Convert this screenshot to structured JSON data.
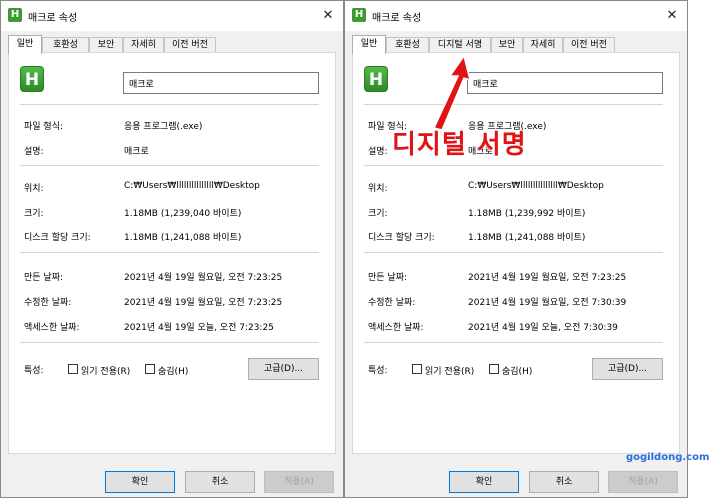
{
  "dialogs": [
    {
      "title": "매크로 속성",
      "close_glyph": "✕",
      "app_icon_letter": "H",
      "tabs": [
        "일반",
        "호환성",
        "보안",
        "자세히",
        "이전 버전"
      ],
      "filename": "매크로",
      "props": [
        {
          "label": "파일 형식:",
          "value": "응용 프로그램(.exe)"
        },
        {
          "label": "설명:",
          "value": "매크로"
        },
        {
          "label": "위치:",
          "value": "C:₩Users₩lllllllllllllll₩Desktop"
        },
        {
          "label": "크기:",
          "value": "1.18MB (1,239,040 바이트)"
        },
        {
          "label": "디스크 할당 크기:",
          "value": "1.18MB (1,241,088 바이트)"
        },
        {
          "label": "만든 날짜:",
          "value": "2021년 4월 19일 월요일, 오전 7:23:25"
        },
        {
          "label": "수정한 날짜:",
          "value": "2021년 4월 19일 월요일, 오전 7:23:25"
        },
        {
          "label": "액세스한 날짜:",
          "value": "2021년 4월 19일 오늘, 오전 7:23:25"
        }
      ],
      "attributes_label": "특성:",
      "readonly_label": "읽기 전용(R)",
      "hidden_label": "숨김(H)",
      "advanced_label": "고급(D)...",
      "ok_label": "확인",
      "cancel_label": "취소",
      "apply_label": "적용(A)"
    },
    {
      "title": "매크로 속성",
      "close_glyph": "✕",
      "app_icon_letter": "H",
      "tabs": [
        "일반",
        "호환성",
        "디지털 서명",
        "보안",
        "자세히",
        "이전 버전"
      ],
      "filename": "매크로",
      "props": [
        {
          "label": "파일 형식:",
          "value": "응용 프로그램(.exe)"
        },
        {
          "label": "설명:",
          "value": "매크로"
        },
        {
          "label": "위치:",
          "value": "C:₩Users₩lllllllllllllll₩Desktop"
        },
        {
          "label": "크기:",
          "value": "1.18MB (1,239,992 바이트)"
        },
        {
          "label": "디스크 할당 크기:",
          "value": "1.18MB (1,241,088 바이트)"
        },
        {
          "label": "만든 날짜:",
          "value": "2021년 4월 19일 월요일, 오전 7:23:25"
        },
        {
          "label": "수정한 날짜:",
          "value": "2021년 4월 19일 월요일, 오전 7:30:39"
        },
        {
          "label": "액세스한 날짜:",
          "value": "2021년 4월 19일 오늘, 오전 7:30:39"
        }
      ],
      "attributes_label": "특성:",
      "readonly_label": "읽기 전용(R)",
      "hidden_label": "숨김(H)",
      "advanced_label": "고급(D)...",
      "ok_label": "확인",
      "cancel_label": "취소",
      "apply_label": "적용(A)"
    }
  ],
  "annotation": "디지털 서명",
  "watermark": "gogildong.com",
  "colors": {
    "annotation": "#e01414",
    "watermark": "#2a6fdb",
    "app_icon": "#3d9b35"
  }
}
